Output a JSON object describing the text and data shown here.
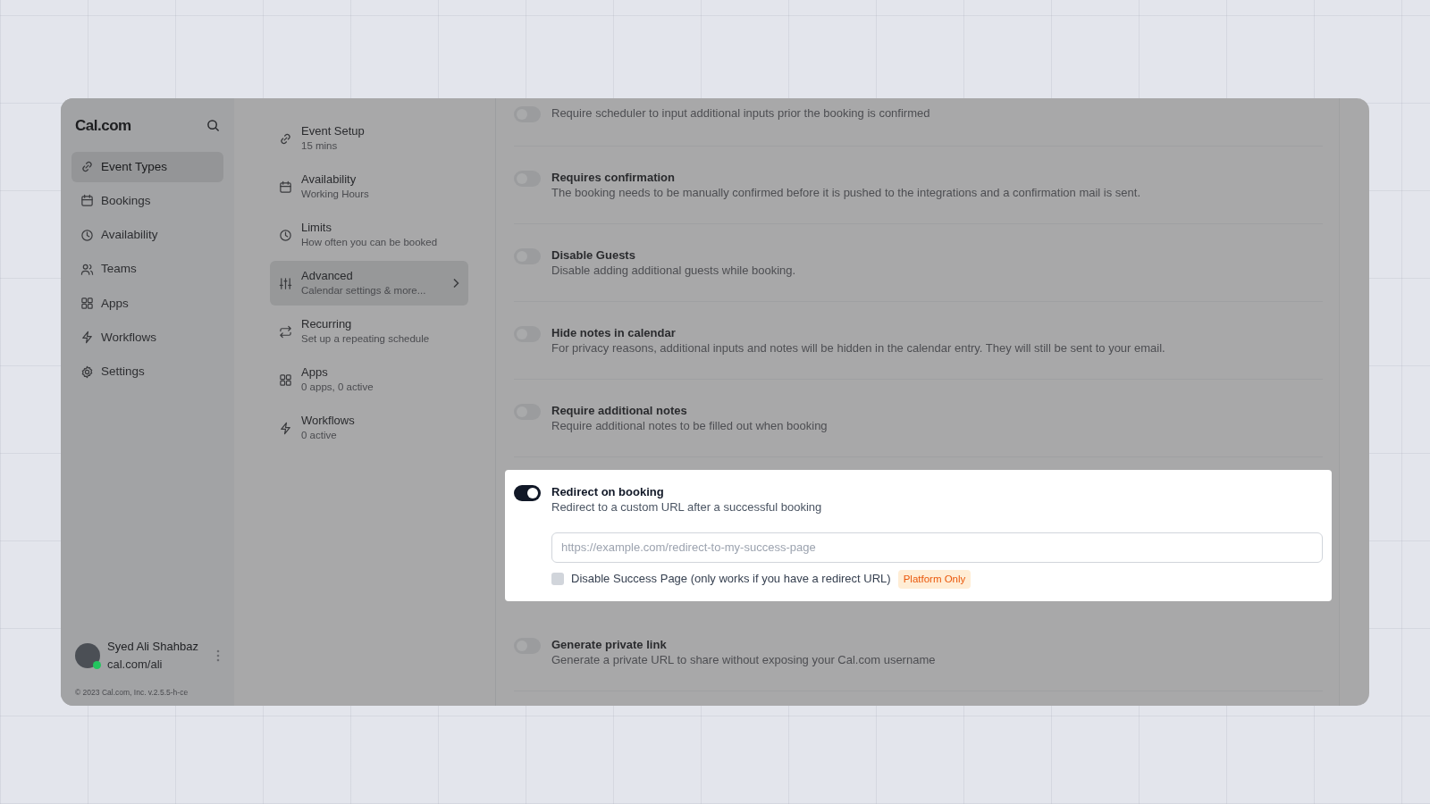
{
  "app": {
    "logo": "Cal.com"
  },
  "nav": [
    {
      "label": "Event Types",
      "selected": true
    },
    {
      "label": "Bookings",
      "selected": false
    },
    {
      "label": "Availability",
      "selected": false
    },
    {
      "label": "Teams",
      "selected": false
    },
    {
      "label": "Apps",
      "selected": false
    },
    {
      "label": "Workflows",
      "selected": false
    },
    {
      "label": "Settings",
      "selected": false
    }
  ],
  "user": {
    "name": "Syed Ali Shahbaz",
    "handle": "cal.com/ali",
    "online": true
  },
  "footer": "© 2023 Cal.com, Inc. v.2.5.5-h-ce",
  "tabs": [
    {
      "title": "Event Setup",
      "subtitle": "15 mins",
      "selected": false
    },
    {
      "title": "Availability",
      "subtitle": "Working Hours",
      "selected": false
    },
    {
      "title": "Limits",
      "subtitle": "How often you can be booked",
      "selected": false
    },
    {
      "title": "Advanced",
      "subtitle": "Calendar settings & more...",
      "selected": true
    },
    {
      "title": "Recurring",
      "subtitle": "Set up a repeating schedule",
      "selected": false
    },
    {
      "title": "Apps",
      "subtitle": "0 apps, 0 active",
      "selected": false
    },
    {
      "title": "Workflows",
      "subtitle": "0 active",
      "selected": false
    }
  ],
  "settings": [
    {
      "description": "Require scheduler to input additional inputs prior the booking is confirmed",
      "on": false,
      "highlighted": false
    },
    {
      "title": "Requires confirmation",
      "description": "The booking needs to be manually confirmed before it is pushed to the integrations and a confirmation mail is sent.",
      "on": false,
      "highlighted": false
    },
    {
      "title": "Disable Guests",
      "description": "Disable adding additional guests while booking.",
      "on": false,
      "highlighted": false
    },
    {
      "title": "Hide notes in calendar",
      "description": "For privacy reasons, additional inputs and notes will be hidden in the calendar entry. They will still be sent to your email.",
      "on": false,
      "highlighted": false
    },
    {
      "title": "Require additional notes",
      "description": "Require additional notes to be filled out when booking",
      "on": false,
      "highlighted": false
    },
    {
      "title": "Redirect on booking",
      "description": "Redirect to a custom URL after a successful booking",
      "on": true,
      "highlighted": true,
      "url_field": {
        "placeholder": "https://example.com/redirect-to-my-success-page"
      },
      "checkbox": {
        "label": "Disable Success Page (only works if you have a redirect URL)",
        "checked": false,
        "badge": "Platform Only"
      }
    },
    {
      "title": "Generate private link",
      "description": "Generate a private URL to share without exposing your Cal.com username",
      "on": false,
      "highlighted": false
    }
  ]
}
